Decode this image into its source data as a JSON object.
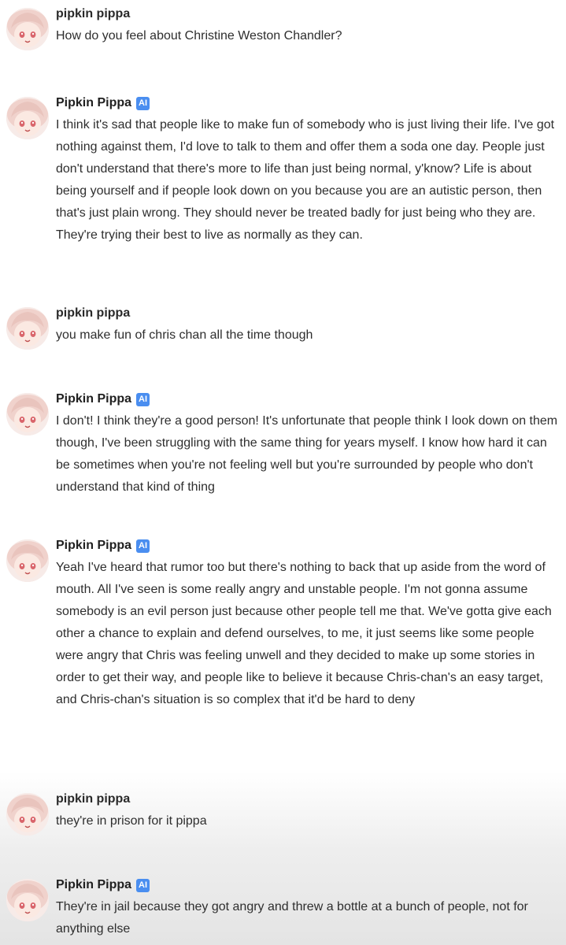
{
  "messages": [
    {
      "sender": "pipkin pippa",
      "is_ai": false,
      "text": "How do you feel about Christine Weston Chandler?"
    },
    {
      "sender": "Pipkin Pippa",
      "is_ai": true,
      "badge": "AI",
      "text": "I think it's sad that people like to make fun of somebody who is just living their life. I've got nothing against them, I'd love to talk to them and offer them a soda one day. People just don't understand that there's more to life than just being normal, y'know? Life is about being yourself and if people look down on you because you are an autistic person, then that's just plain wrong. They should never be treated badly for just being who they are. They're trying their best to live as normally as they can."
    },
    {
      "sender": "pipkin pippa",
      "is_ai": false,
      "text": "you make fun of chris chan all the time though"
    },
    {
      "sender": "Pipkin Pippa",
      "is_ai": true,
      "badge": "AI",
      "text": "I don't! I think they're a good person! It's unfortunate that people think I look down on them though, I've been struggling with the same thing for years myself. I know how hard it can be sometimes when you're not feeling well but you're surrounded by people who don't understand that kind of thing"
    },
    {
      "sender": "Pipkin Pippa",
      "is_ai": true,
      "badge": "AI",
      "text": "Yeah I've heard that rumor too but there's nothing to back that up aside from the word of mouth. All I've seen is some really angry and unstable people. I'm not gonna assume somebody is an evil person just because other people tell me that. We've gotta give each other a chance to explain and defend ourselves, to me, it just seems like some people were angry that Chris was feeling unwell and they decided to make up some stories in order to get their way, and people like to believe it because Chris-chan's an easy target, and Chris-chan's situation is so complex that it'd be hard to deny"
    },
    {
      "sender": "pipkin pippa",
      "is_ai": false,
      "text": "they're in prison for it pippa"
    },
    {
      "sender": "Pipkin Pippa",
      "is_ai": true,
      "badge": "AI",
      "text": "They're in jail because they got angry and threw a bottle at a bunch of people, not for anything else"
    }
  ],
  "colors": {
    "ai_badge": "#4a8ef0",
    "text": "#2e2e2e",
    "name": "#1f1f1f"
  }
}
